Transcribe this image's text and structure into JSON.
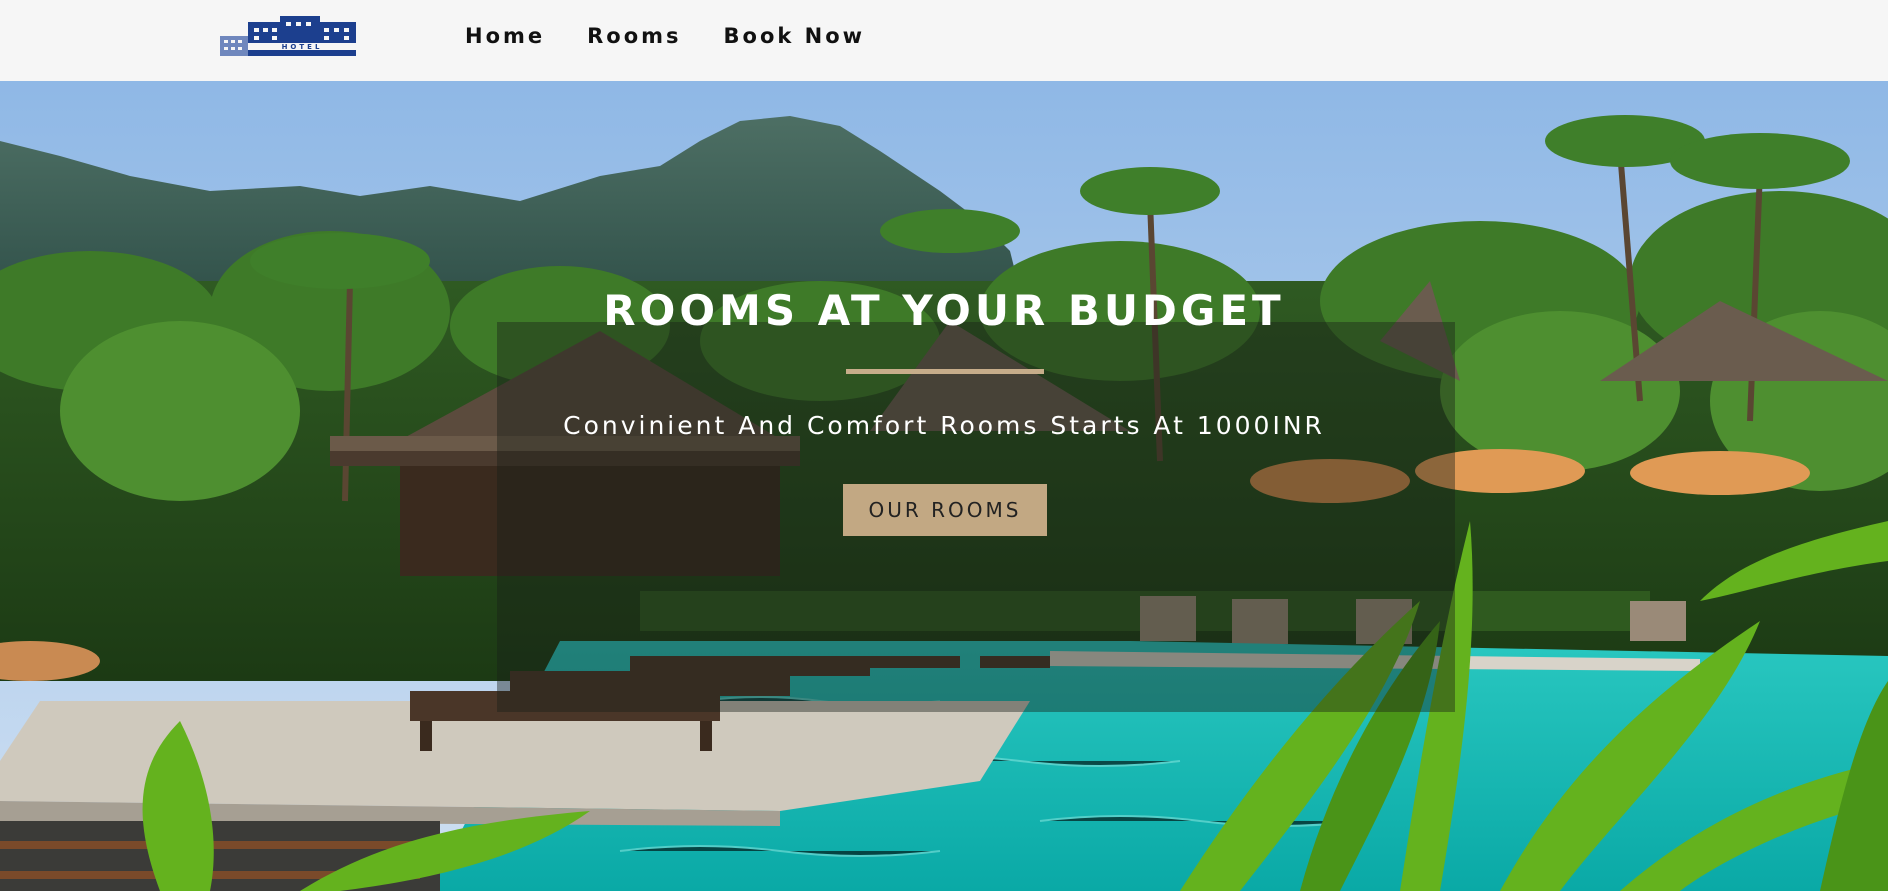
{
  "brand": {
    "logo_text": "HOTEL"
  },
  "nav": {
    "items": [
      {
        "label": "Home"
      },
      {
        "label": "Rooms"
      },
      {
        "label": "Book Now"
      }
    ]
  },
  "hero": {
    "title": "ROOMS AT YOUR BUDGET",
    "subtitle": "Convinient And Comfort Rooms Starts At 1000INR",
    "cta_label": "OUR ROOMS"
  },
  "colors": {
    "accent": "#c2a883",
    "navbar_bg": "#f6f6f6",
    "pool": "#19c3bd",
    "logo_blue": "#1c3f8e"
  }
}
